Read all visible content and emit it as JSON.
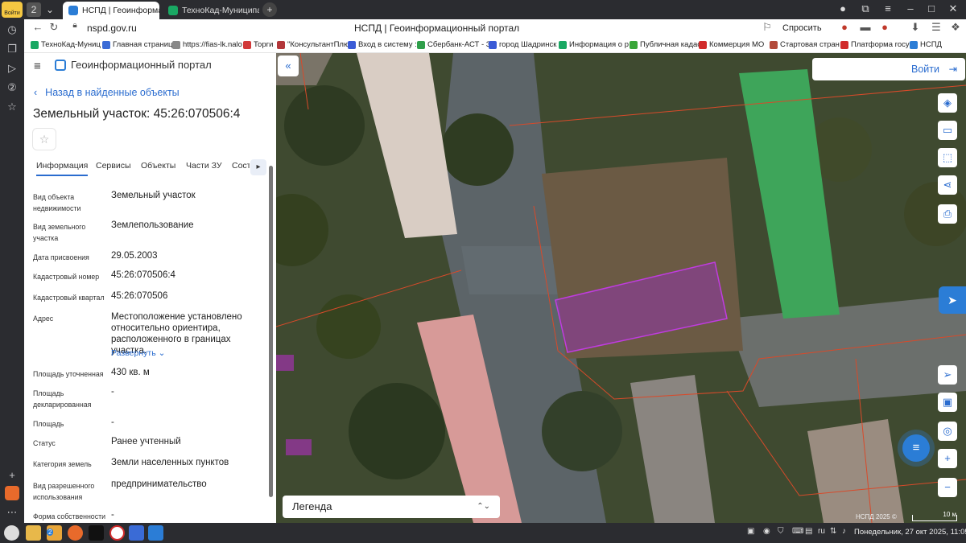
{
  "os_dock": {
    "login_label": "Войти",
    "icons": [
      "clock-icon",
      "layers-icon",
      "play-icon",
      "counter-icon",
      "star-icon"
    ]
  },
  "browser": {
    "tab_count": "2",
    "tabs": [
      {
        "label": "НСПД | Геоинформацион",
        "color": "#2b7dd6"
      },
      {
        "label": "ТехноКад-Муниципалите",
        "color": "#19a863"
      }
    ],
    "url": "nspd.gov.ru",
    "page_title": "НСПД | Геоинформационный портал",
    "ask_label": "Спросить",
    "bookmarks": [
      {
        "label": "ТехноКад-Муниц",
        "color": "#19a863"
      },
      {
        "label": "Главная страниц",
        "color": "#3a6bd6"
      },
      {
        "label": "https://fias-lk.nalo",
        "color": "#888888"
      },
      {
        "label": "Торги",
        "color": "#d13a3a"
      },
      {
        "label": "\"КонсультантПлю",
        "color": "#b3373a"
      },
      {
        "label": "Вход в систему ::",
        "color": "#3a5bd6"
      },
      {
        "label": "Сбербанк-АСТ - З",
        "color": "#2f9e4a"
      },
      {
        "label": "город Шадринск",
        "color": "#3a5bd6"
      },
      {
        "label": "Информация о р",
        "color": "#19a863"
      },
      {
        "label": "Публичная кадас",
        "color": "#3aa63a"
      },
      {
        "label": "Коммерция МО",
        "color": "#d12b2b"
      },
      {
        "label": "Стартовая стран",
        "color": "#b34a3a"
      },
      {
        "label": "Платформа госу",
        "color": "#d12b2b"
      },
      {
        "label": "НСПД",
        "color": "#2b7dd6"
      }
    ]
  },
  "panel": {
    "brand": "Геоинформационный портал",
    "back_link": "Назад в найденные объекты",
    "title": "Земельный участок: 45:26:070506:4",
    "tabs": [
      "Информация",
      "Сервисы",
      "Объекты",
      "Части ЗУ",
      "Состав"
    ],
    "properties": [
      {
        "key": "Вид объекта недвижимости",
        "value": "Земельный участок"
      },
      {
        "key": "Вид земельного участка",
        "value": "Землепользование"
      },
      {
        "key": "Дата присвоения",
        "value": "29.05.2003"
      },
      {
        "key": "Кадастровый номер",
        "value": "45:26:070506:4"
      },
      {
        "key": "Кадастровый квартал",
        "value": "45:26:070506"
      },
      {
        "key": "Адрес",
        "value": "Местоположение установлено относительно ориентира, расположенного в границах участка."
      },
      {
        "key": "Площадь уточненная",
        "value": "430 кв. м"
      },
      {
        "key": "Площадь декларированная",
        "value": "-"
      },
      {
        "key": "Площадь",
        "value": "-"
      },
      {
        "key": "Статус",
        "value": "Ранее учтенный"
      },
      {
        "key": "Категория земель",
        "value": "Земли населенных пунктов"
      },
      {
        "key": "Вид разрешенного использования",
        "value": "предпринимательство"
      },
      {
        "key": "Форма собственности",
        "value": "-"
      }
    ],
    "expand_label": "Развернуть"
  },
  "map": {
    "login_label": "Войти",
    "legend_label": "Легенда",
    "copyright": "НСПД 2025 ©",
    "scale": "10 м",
    "accent": "#2a6ccf",
    "parcel_color": "#9b2fbf"
  },
  "taskbar": {
    "badge": "2",
    "lang": "ru",
    "clock": "Понедельник, 27 окт 2025, 11:05"
  }
}
